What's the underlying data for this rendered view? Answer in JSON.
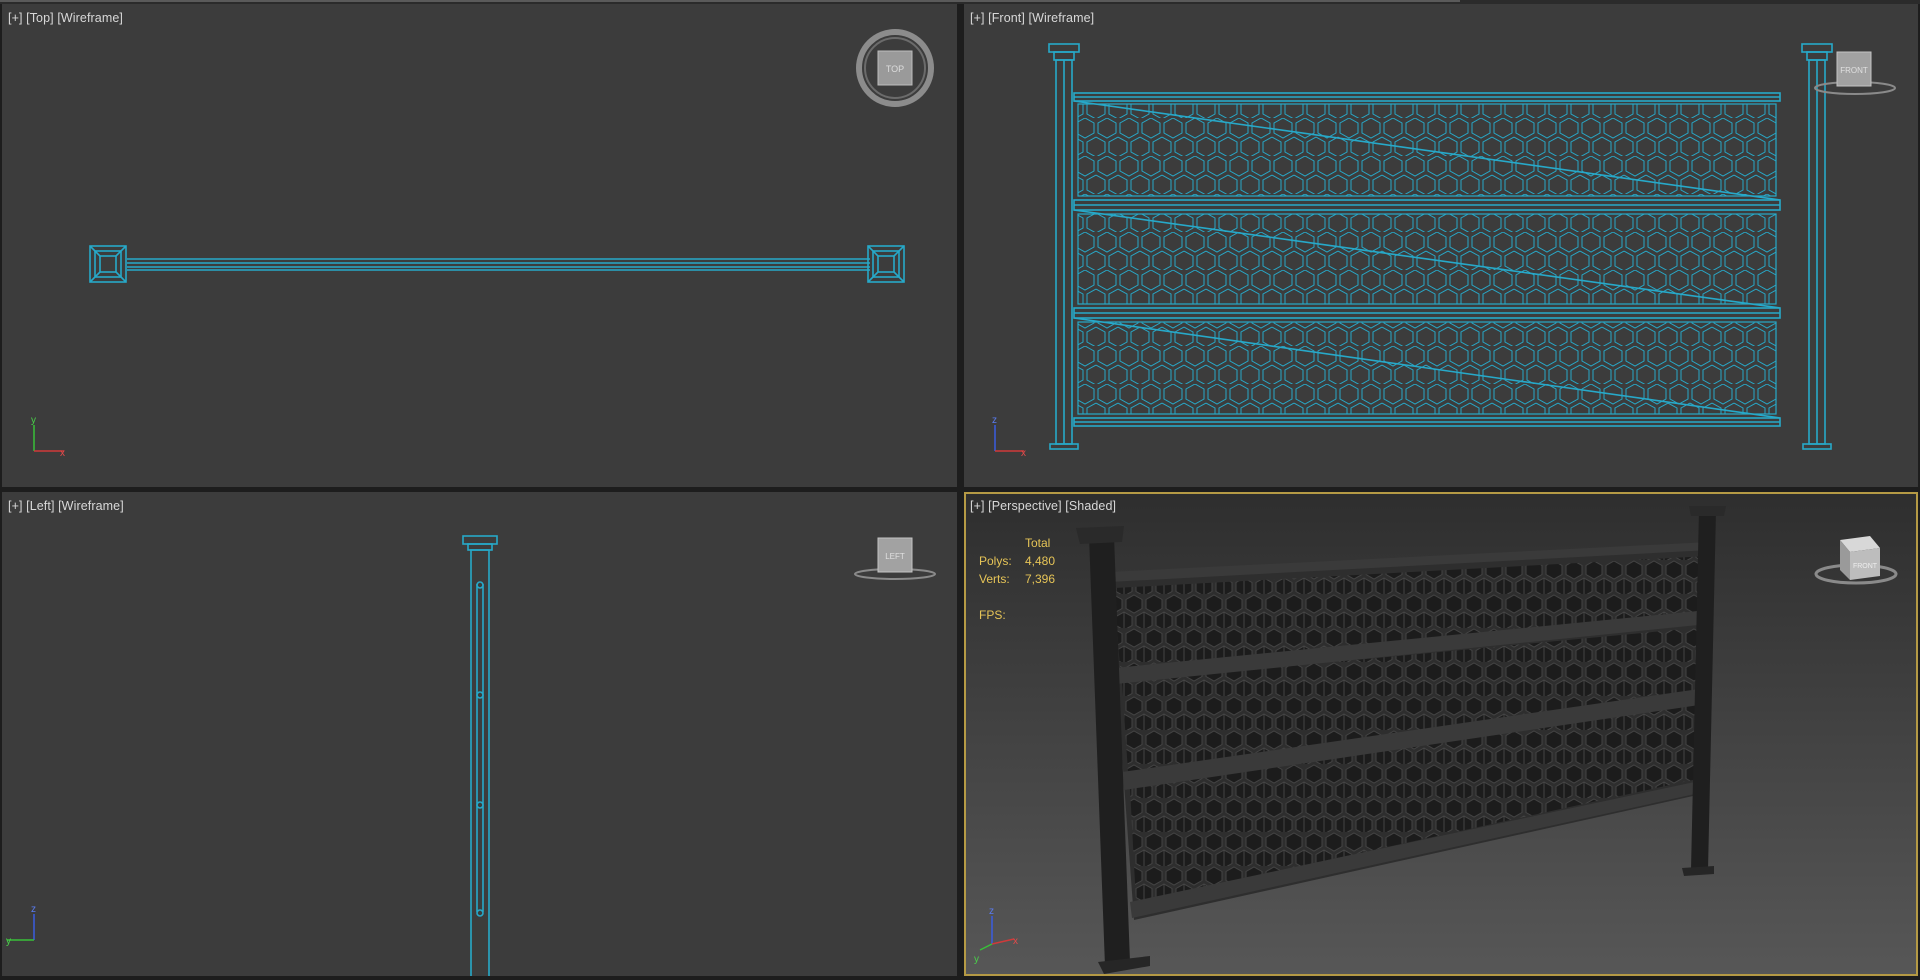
{
  "viewports": {
    "top": {
      "plus": "[+]",
      "view": "[Top]",
      "mode": "[Wireframe]",
      "cube": "TOP"
    },
    "front": {
      "plus": "[+]",
      "view": "[Front]",
      "mode": "[Wireframe]",
      "cube": "FRONT"
    },
    "left": {
      "plus": "[+]",
      "view": "[Left]",
      "mode": "[Wireframe]",
      "cube": "LEFT"
    },
    "perspective": {
      "plus": "[+]",
      "view": "[Perspective]",
      "mode": "[Shaded]",
      "cube": "FRONT",
      "active": true
    }
  },
  "stats": {
    "header": "Total",
    "polys_label": "Polys:",
    "polys_value": "4,480",
    "verts_label": "Verts:",
    "verts_value": "7,396",
    "fps_label": "FPS:"
  },
  "axis_labels": {
    "x": "x",
    "y": "y",
    "z": "z"
  },
  "colors": {
    "wireframe": "#27a9c9",
    "viewport_bg": "#3c3c3c",
    "active_border": "#b59a45",
    "stats_text": "#e6c457",
    "label_text": "#d8d8d8"
  }
}
